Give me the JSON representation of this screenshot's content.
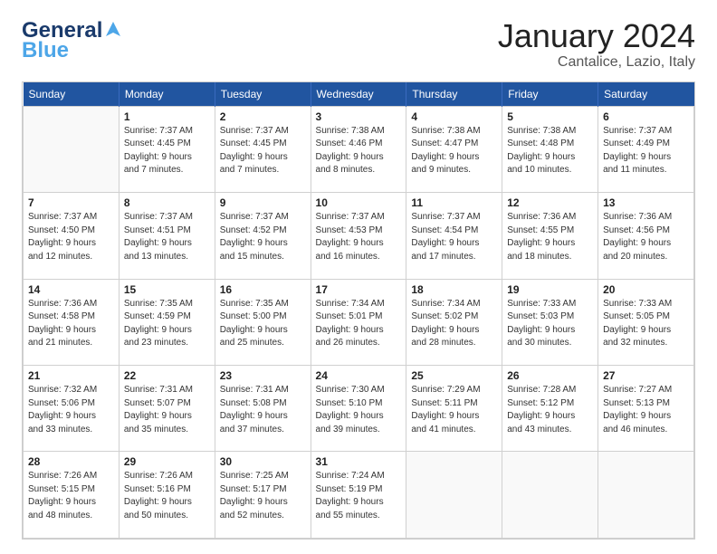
{
  "logo": {
    "line1": "General",
    "line2": "Blue"
  },
  "title": "January 2024",
  "subtitle": "Cantalice, Lazio, Italy",
  "weekdays": [
    "Sunday",
    "Monday",
    "Tuesday",
    "Wednesday",
    "Thursday",
    "Friday",
    "Saturday"
  ],
  "weeks": [
    [
      {
        "day": "",
        "info": ""
      },
      {
        "day": "1",
        "info": "Sunrise: 7:37 AM\nSunset: 4:45 PM\nDaylight: 9 hours\nand 7 minutes."
      },
      {
        "day": "2",
        "info": "Sunrise: 7:37 AM\nSunset: 4:45 PM\nDaylight: 9 hours\nand 7 minutes."
      },
      {
        "day": "3",
        "info": "Sunrise: 7:38 AM\nSunset: 4:46 PM\nDaylight: 9 hours\nand 8 minutes."
      },
      {
        "day": "4",
        "info": "Sunrise: 7:38 AM\nSunset: 4:47 PM\nDaylight: 9 hours\nand 9 minutes."
      },
      {
        "day": "5",
        "info": "Sunrise: 7:38 AM\nSunset: 4:48 PM\nDaylight: 9 hours\nand 10 minutes."
      },
      {
        "day": "6",
        "info": "Sunrise: 7:37 AM\nSunset: 4:49 PM\nDaylight: 9 hours\nand 11 minutes."
      }
    ],
    [
      {
        "day": "7",
        "info": "Sunrise: 7:37 AM\nSunset: 4:50 PM\nDaylight: 9 hours\nand 12 minutes."
      },
      {
        "day": "8",
        "info": "Sunrise: 7:37 AM\nSunset: 4:51 PM\nDaylight: 9 hours\nand 13 minutes."
      },
      {
        "day": "9",
        "info": "Sunrise: 7:37 AM\nSunset: 4:52 PM\nDaylight: 9 hours\nand 15 minutes."
      },
      {
        "day": "10",
        "info": "Sunrise: 7:37 AM\nSunset: 4:53 PM\nDaylight: 9 hours\nand 16 minutes."
      },
      {
        "day": "11",
        "info": "Sunrise: 7:37 AM\nSunset: 4:54 PM\nDaylight: 9 hours\nand 17 minutes."
      },
      {
        "day": "12",
        "info": "Sunrise: 7:36 AM\nSunset: 4:55 PM\nDaylight: 9 hours\nand 18 minutes."
      },
      {
        "day": "13",
        "info": "Sunrise: 7:36 AM\nSunset: 4:56 PM\nDaylight: 9 hours\nand 20 minutes."
      }
    ],
    [
      {
        "day": "14",
        "info": "Sunrise: 7:36 AM\nSunset: 4:58 PM\nDaylight: 9 hours\nand 21 minutes."
      },
      {
        "day": "15",
        "info": "Sunrise: 7:35 AM\nSunset: 4:59 PM\nDaylight: 9 hours\nand 23 minutes."
      },
      {
        "day": "16",
        "info": "Sunrise: 7:35 AM\nSunset: 5:00 PM\nDaylight: 9 hours\nand 25 minutes."
      },
      {
        "day": "17",
        "info": "Sunrise: 7:34 AM\nSunset: 5:01 PM\nDaylight: 9 hours\nand 26 minutes."
      },
      {
        "day": "18",
        "info": "Sunrise: 7:34 AM\nSunset: 5:02 PM\nDaylight: 9 hours\nand 28 minutes."
      },
      {
        "day": "19",
        "info": "Sunrise: 7:33 AM\nSunset: 5:03 PM\nDaylight: 9 hours\nand 30 minutes."
      },
      {
        "day": "20",
        "info": "Sunrise: 7:33 AM\nSunset: 5:05 PM\nDaylight: 9 hours\nand 32 minutes."
      }
    ],
    [
      {
        "day": "21",
        "info": "Sunrise: 7:32 AM\nSunset: 5:06 PM\nDaylight: 9 hours\nand 33 minutes."
      },
      {
        "day": "22",
        "info": "Sunrise: 7:31 AM\nSunset: 5:07 PM\nDaylight: 9 hours\nand 35 minutes."
      },
      {
        "day": "23",
        "info": "Sunrise: 7:31 AM\nSunset: 5:08 PM\nDaylight: 9 hours\nand 37 minutes."
      },
      {
        "day": "24",
        "info": "Sunrise: 7:30 AM\nSunset: 5:10 PM\nDaylight: 9 hours\nand 39 minutes."
      },
      {
        "day": "25",
        "info": "Sunrise: 7:29 AM\nSunset: 5:11 PM\nDaylight: 9 hours\nand 41 minutes."
      },
      {
        "day": "26",
        "info": "Sunrise: 7:28 AM\nSunset: 5:12 PM\nDaylight: 9 hours\nand 43 minutes."
      },
      {
        "day": "27",
        "info": "Sunrise: 7:27 AM\nSunset: 5:13 PM\nDaylight: 9 hours\nand 46 minutes."
      }
    ],
    [
      {
        "day": "28",
        "info": "Sunrise: 7:26 AM\nSunset: 5:15 PM\nDaylight: 9 hours\nand 48 minutes."
      },
      {
        "day": "29",
        "info": "Sunrise: 7:26 AM\nSunset: 5:16 PM\nDaylight: 9 hours\nand 50 minutes."
      },
      {
        "day": "30",
        "info": "Sunrise: 7:25 AM\nSunset: 5:17 PM\nDaylight: 9 hours\nand 52 minutes."
      },
      {
        "day": "31",
        "info": "Sunrise: 7:24 AM\nSunset: 5:19 PM\nDaylight: 9 hours\nand 55 minutes."
      },
      {
        "day": "",
        "info": ""
      },
      {
        "day": "",
        "info": ""
      },
      {
        "day": "",
        "info": ""
      }
    ]
  ]
}
